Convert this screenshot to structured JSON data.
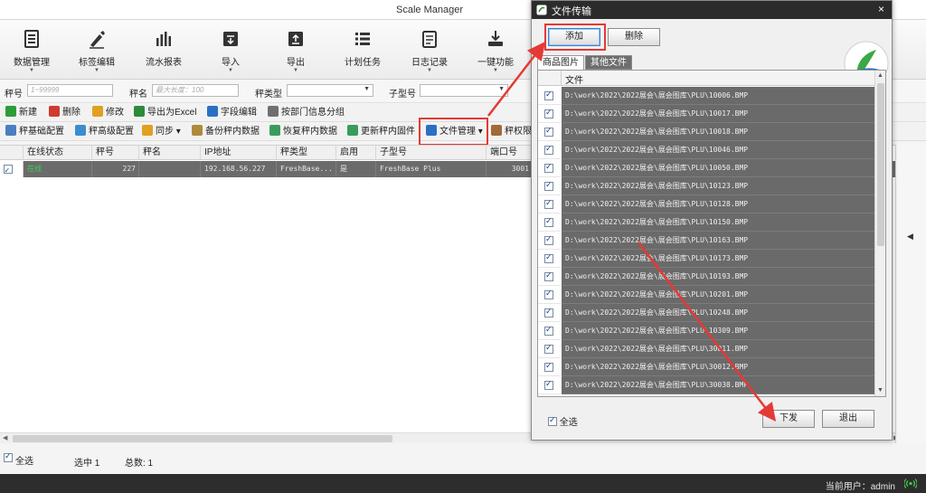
{
  "window": {
    "title": "Scale Manager"
  },
  "ribbon": [
    {
      "label": "数据管理",
      "icon": "data-management-icon",
      "dropdown": true
    },
    {
      "label": "标签编辑",
      "icon": "label-edit-icon",
      "dropdown": true
    },
    {
      "label": "流水报表",
      "icon": "report-chart-icon",
      "dropdown": false
    },
    {
      "label": "导入",
      "icon": "import-icon",
      "dropdown": true
    },
    {
      "label": "导出",
      "icon": "export-icon",
      "dropdown": true
    },
    {
      "label": "计划任务",
      "icon": "task-list-icon",
      "dropdown": false
    },
    {
      "label": "日志记录",
      "icon": "log-icon",
      "dropdown": true
    },
    {
      "label": "一键功能",
      "icon": "one-key-icon",
      "dropdown": true
    }
  ],
  "filters": {
    "scale_no_label": "秤号",
    "scale_no_placeholder": "1~99999",
    "scale_name_label": "秤名",
    "scale_name_placeholder": "最大长度：100",
    "scale_type_label": "秤类型",
    "model_label": "子型号"
  },
  "toolbar1": [
    {
      "label": "新建",
      "color": "#2e9c3a"
    },
    {
      "label": "删除",
      "color": "#d03a2f"
    },
    {
      "label": "修改",
      "color": "#e0a020"
    },
    {
      "label": "导出为Excel",
      "color": "#2e8a3a"
    },
    {
      "label": "字段编辑",
      "color": "#2b6fc4"
    },
    {
      "label": "按部门信息分组",
      "color": "#707070"
    }
  ],
  "toolbar2": [
    {
      "label": "秤基础配置",
      "color": "#4a7fc0"
    },
    {
      "label": "秤高级配置",
      "color": "#3a8ed0"
    },
    {
      "label": "同步",
      "color": "#e0a020"
    },
    {
      "label": "备份秤内数据",
      "color": "#b08a3a"
    },
    {
      "label": "恢复秤内数据",
      "color": "#3a9c5a"
    },
    {
      "label": "更新秤内固件",
      "color": "#3a9c5a"
    },
    {
      "label": "文件管理",
      "color": "#2b6fc4"
    },
    {
      "label": "秤权限",
      "color": "#a06a3a"
    }
  ],
  "grid": {
    "headers": [
      "在线状态",
      "秤号",
      "秤名",
      "IP地址",
      "秤类型",
      "启用",
      "子型号",
      "端口号"
    ],
    "row": {
      "status": "在线",
      "scale_no": "227",
      "scale_name": "",
      "ip": "192.168.56.227",
      "type": "FreshBase...",
      "enabled": "是",
      "model": "FreshBase Plus",
      "port": "3001"
    }
  },
  "status": {
    "select_all": "全选",
    "selected": "选中 1",
    "total": "总数: 1"
  },
  "bottom": {
    "current_user": "当前用户：admin"
  },
  "dialog": {
    "title": "文件传输",
    "add_button": "添加",
    "delete_button": "删除",
    "tabs": [
      "商品图片",
      "其他文件"
    ],
    "column_header": "文件",
    "files": [
      "D:\\work\\2022\\2022展会\\展会图库\\PLU\\10006.BMP",
      "D:\\work\\2022\\2022展会\\展会图库\\PLU\\10017.BMP",
      "D:\\work\\2022\\2022展会\\展会图库\\PLU\\10018.BMP",
      "D:\\work\\2022\\2022展会\\展会图库\\PLU\\10046.BMP",
      "D:\\work\\2022\\2022展会\\展会图库\\PLU\\10050.BMP",
      "D:\\work\\2022\\2022展会\\展会图库\\PLU\\10123.BMP",
      "D:\\work\\2022\\2022展会\\展会图库\\PLU\\10128.BMP",
      "D:\\work\\2022\\2022展会\\展会图库\\PLU\\10150.BMP",
      "D:\\work\\2022\\2022展会\\展会图库\\PLU\\10163.BMP",
      "D:\\work\\2022\\2022展会\\展会图库\\PLU\\10173.BMP",
      "D:\\work\\2022\\2022展会\\展会图库\\PLU\\10193.BMP",
      "D:\\work\\2022\\2022展会\\展会图库\\PLU\\10201.BMP",
      "D:\\work\\2022\\2022展会\\展会图库\\PLU\\10248.BMP",
      "D:\\work\\2022\\2022展会\\展会图库\\PLU\\10309.BMP",
      "D:\\work\\2022\\2022展会\\展会图库\\PLU\\30011.BMP",
      "D:\\work\\2022\\2022展会\\展会图库\\PLU\\30012.BMP",
      "D:\\work\\2022\\2022展会\\展会图库\\PLU\\30038.BMP"
    ],
    "select_all": "全选",
    "send_button": "下发",
    "exit_button": "退出"
  },
  "annotation_color": "#e53935"
}
